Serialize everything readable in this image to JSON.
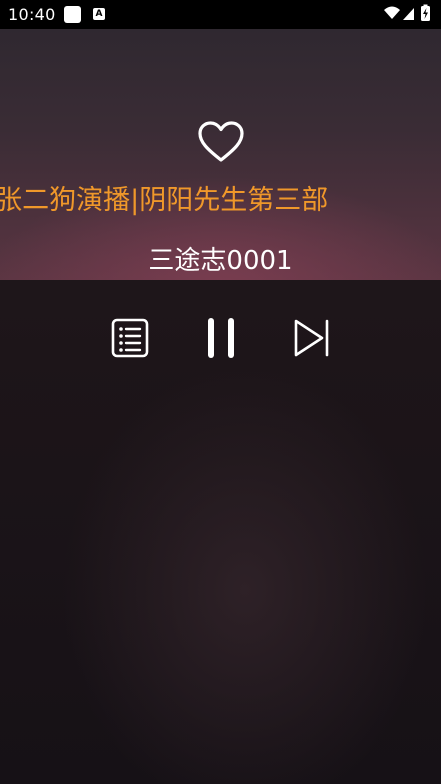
{
  "status_bar": {
    "time": "10:40",
    "icons": [
      "notification-square-icon",
      "a-badge-icon",
      "wifi-icon",
      "signal-icon",
      "battery-charging-icon"
    ],
    "badge_letter": "A"
  },
  "player": {
    "program_title": "|张二狗演播|阴阳先生第三部",
    "episode_title": "三途志0001",
    "favorite_icon": "heart-outline-icon",
    "controls": [
      {
        "name": "playlist",
        "icon": "playlist-icon"
      },
      {
        "name": "pause",
        "icon": "pause-icon"
      },
      {
        "name": "next",
        "icon": "skip-next-icon"
      }
    ]
  },
  "colors": {
    "title_accent": "#f0982a",
    "text": "#ffffff",
    "background": "#1b1419"
  }
}
